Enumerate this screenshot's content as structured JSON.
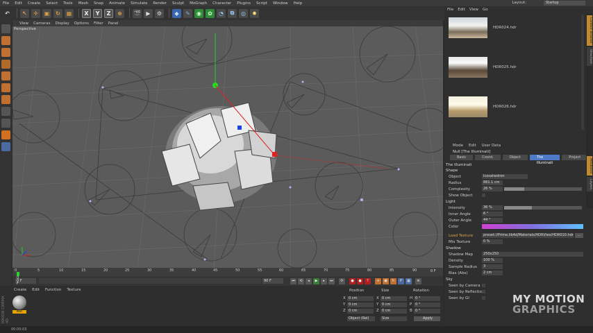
{
  "menubar": {
    "items": [
      "File",
      "Edit",
      "Create",
      "Select",
      "Tools",
      "Mesh",
      "Snap",
      "Animate",
      "Simulate",
      "Render",
      "Sculpt",
      "MoGraph",
      "Character",
      "Plugins",
      "Script",
      "Window",
      "Help"
    ],
    "layout_label": "Layout:",
    "layout_value": "Startup"
  },
  "toolbar": {
    "axis_x": "X",
    "axis_y": "Y",
    "axis_z": "Z"
  },
  "viewport": {
    "menu": [
      "View",
      "Cameras",
      "Display",
      "Options",
      "Filter",
      "Panel"
    ],
    "label": "Perspective"
  },
  "timeline": {
    "ticks": [
      "0",
      "5",
      "10",
      "15",
      "20",
      "25",
      "30",
      "35",
      "40",
      "45",
      "50",
      "55",
      "60",
      "65",
      "70",
      "75",
      "80",
      "85",
      "90"
    ],
    "end_frame": "0 F"
  },
  "transport": {
    "current_frame": "0 F",
    "start_frame": "0 F",
    "end_frame": "90 F"
  },
  "material_manager": {
    "menu": [
      "Create",
      "Edit",
      "Function",
      "Texture"
    ],
    "material_name": "Mat",
    "logo_text": "MAXON CINEMA 4D"
  },
  "coordinates": {
    "headers": [
      "Position",
      "Size",
      "Rotation"
    ],
    "rows": [
      {
        "axis": "X",
        "pos": "0 cm",
        "size_axis": "X",
        "size": "0 cm",
        "rot_axis": "H",
        "rot": "0 °"
      },
      {
        "axis": "Y",
        "pos": "0 cm",
        "size_axis": "Y",
        "size": "0 cm",
        "rot_axis": "P",
        "rot": "0 °"
      },
      {
        "axis": "Z",
        "pos": "0 cm",
        "size_axis": "Z",
        "size": "0 cm",
        "rot_axis": "B",
        "rot": "0 °"
      }
    ],
    "mode": "Object (Rel)",
    "size_mode": "Size",
    "apply": "Apply"
  },
  "status": {
    "time": "00:00:03"
  },
  "content_browser": {
    "menu": [
      "File",
      "Edit",
      "View",
      "Go"
    ],
    "items": [
      "HDR024.hdr",
      "HDR025.hdr",
      "HDR026.hdr"
    ]
  },
  "attributes": {
    "menu": [
      "Mode",
      "Edit",
      "User Data"
    ],
    "object_title": "Null [The Illuminati]",
    "tabs": [
      "Basic",
      "Coord.",
      "Object",
      "The Illuminati",
      "Project"
    ],
    "section_title": "The Illuminati",
    "shape_section": "Shape",
    "object_label": "Object",
    "object_value": "Icosahedron",
    "radius_label": "Radius",
    "radius_value": "881.1 cm",
    "complexity_label": "Complexity",
    "complexity_value": "26 %",
    "complexity_level": 0.26,
    "show_object_label": "Show Object",
    "light_section": "Light",
    "intensity_label": "Intensity",
    "intensity_value": "36 %",
    "intensity_level": 0.36,
    "inner_angle_label": "Inner Angle",
    "inner_angle_value": "6 °",
    "outer_angle_label": "Outer Angle",
    "outer_angle_value": "44 °",
    "color_label": "Color",
    "load_texture_label": "Load Texture",
    "load_texture_value": "preset://Prime.lib4d/Materials/HDRI/tex/HDR010.hdr",
    "mix_texture_label": "Mix Texture",
    "mix_texture_value": "0 %",
    "shadow_section": "Shadow",
    "shadow_map_label": "Shadow Map",
    "shadow_map_value": "250x250",
    "density_label": "Density",
    "density_value": "100 %",
    "sample_radius_label": "Sample Radius",
    "sample_radius_value": "3",
    "bias_label": "Bias (Abs)",
    "bias_value": "2 cm",
    "sky_section": "Sky",
    "seen_camera_label": "Seen by Camera",
    "seen_reflection_label": "Seen by Reflection",
    "seen_gi_label": "Seen by GI"
  },
  "side_tabs": [
    "Content Browser",
    "Structure",
    "Attributes",
    "Layers"
  ],
  "watermark": {
    "line1": "MY MOTION",
    "line2": "GRAPHICS"
  },
  "colors": {
    "accent": "#4e7ac7",
    "viewport_bg": "#5b5b5b",
    "axis_x": "#e02020",
    "axis_y": "#20d020",
    "axis_z": "#2040e0"
  }
}
